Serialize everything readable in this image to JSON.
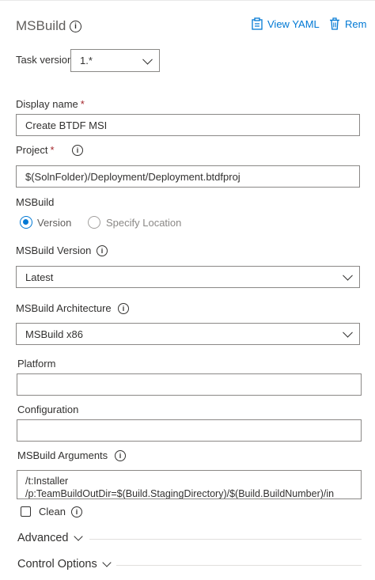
{
  "header": {
    "title": "MSBuild",
    "view_yaml": "View YAML",
    "remove": "Rem"
  },
  "task_version": {
    "label": "Task version",
    "value": "1.*"
  },
  "display_name": {
    "label": "Display name",
    "required": "*",
    "value": "Create BTDF MSI"
  },
  "project": {
    "label": "Project",
    "required": "*",
    "value": "$(SolnFolder)/Deployment/Deployment.btdfproj"
  },
  "msbuild": {
    "label": "MSBuild",
    "options": [
      "Version",
      "Specify Location"
    ],
    "selected": "Version"
  },
  "msbuild_version": {
    "label": "MSBuild Version",
    "value": "Latest"
  },
  "msbuild_architecture": {
    "label": "MSBuild Architecture",
    "value": "MSBuild x86"
  },
  "platform": {
    "label": "Platform",
    "value": ""
  },
  "configuration": {
    "label": "Configuration",
    "value": ""
  },
  "msbuild_arguments": {
    "label": "MSBuild Arguments",
    "line1": "/t:Installer",
    "line2": "/p:TeamBuildOutDir=$(Build.StagingDirectory)/$(Build.BuildNumber)/in"
  },
  "clean": {
    "label": "Clean",
    "checked": false
  },
  "sections": {
    "advanced": "Advanced",
    "control_options": "Control Options"
  },
  "colors": {
    "accent": "#0078d4",
    "required": "#a4262c",
    "border": "#8a8886"
  },
  "icons": {
    "info": "info-icon",
    "yaml": "clipboard-icon",
    "remove": "trash-icon",
    "dropdown": "chevron-down-icon"
  }
}
